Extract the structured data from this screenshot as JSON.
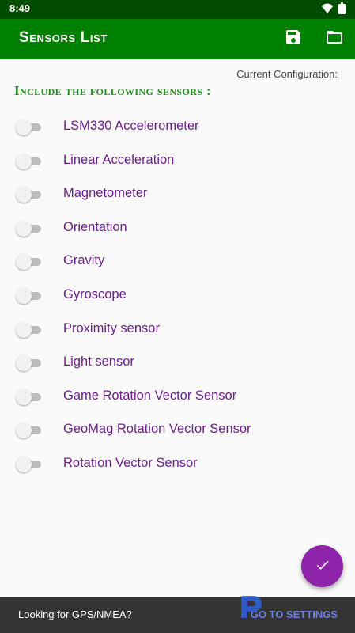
{
  "status_bar": {
    "time": "8:49",
    "icons": [
      "wifi-icon",
      "battery-icon"
    ]
  },
  "app_bar": {
    "title": "Sensors List",
    "actions": [
      "save-icon",
      "folder-icon"
    ],
    "color": "#008000"
  },
  "config_label": "Current Configuration:",
  "section_header": "Include the following sensors :",
  "sensors": [
    {
      "label": "LSM330 Accelerometer",
      "enabled": false
    },
    {
      "label": "Linear Acceleration",
      "enabled": false
    },
    {
      "label": "Magnetometer",
      "enabled": false
    },
    {
      "label": "Orientation",
      "enabled": false
    },
    {
      "label": "Gravity",
      "enabled": false
    },
    {
      "label": "Gyroscope",
      "enabled": false
    },
    {
      "label": "Proximity sensor",
      "enabled": false
    },
    {
      "label": "Light sensor",
      "enabled": false
    },
    {
      "label": "Game Rotation Vector Sensor",
      "enabled": false
    },
    {
      "label": "GeoMag Rotation Vector Sensor",
      "enabled": false
    },
    {
      "label": "Rotation Vector Sensor",
      "enabled": false
    }
  ],
  "fab": {
    "icon": "check-icon",
    "color": "#8e24aa"
  },
  "snackbar": {
    "message": "Looking for GPS/NMEA?",
    "action": "GO TO SETTINGS"
  }
}
